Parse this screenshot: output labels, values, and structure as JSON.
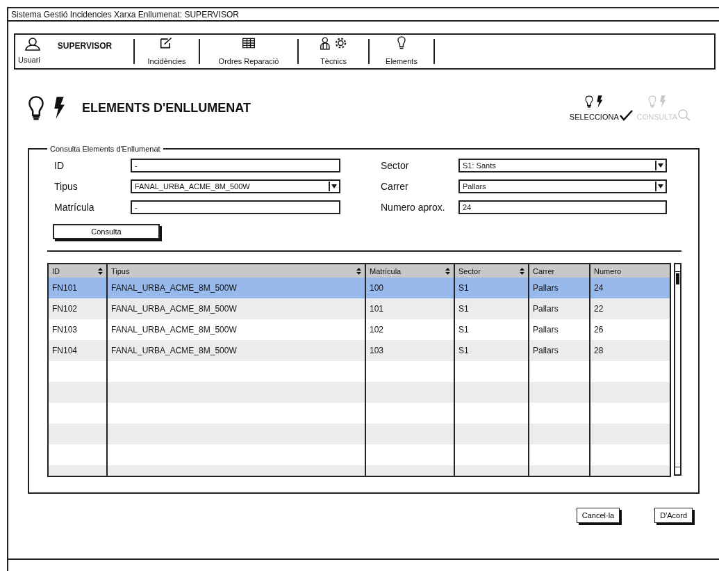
{
  "window": {
    "title": "Sistema Gestió Incidencies Xarxa Enllumenat: SUPERVISOR"
  },
  "nav": {
    "user": {
      "name": "SUPERVISOR",
      "label": "Usuari"
    },
    "items": [
      {
        "label": "Incidències"
      },
      {
        "label": "Ordres Reparació"
      },
      {
        "label": "Tècnics"
      },
      {
        "label": "Elements"
      }
    ]
  },
  "heading": "ELEMENTS D'ENLLUMENAT",
  "steps": [
    {
      "label": "SELECCIONA",
      "active": true
    },
    {
      "label": "CONSULTA",
      "active": false
    }
  ],
  "form": {
    "legend": "Consulta Elements d'Enllumenat",
    "fields": [
      {
        "label": "ID",
        "kind": "text",
        "value": "-"
      },
      {
        "label": "Sector",
        "kind": "select",
        "value": "S1: Sants"
      },
      {
        "label": "Tipus",
        "kind": "select",
        "value": "FANAL_URBA_ACME_8M_500W"
      },
      {
        "label": "Carrer",
        "kind": "select",
        "value": "Pallars"
      },
      {
        "label": "Matrícula",
        "kind": "text",
        "value": "-"
      },
      {
        "label": "Numero aprox.",
        "kind": "text",
        "value": "24"
      }
    ],
    "button": "Consulta"
  },
  "table": {
    "columns": [
      {
        "label": "ID",
        "sortable": true
      },
      {
        "label": "Tipus",
        "sortable": true
      },
      {
        "label": "Matrícula",
        "sortable": true
      },
      {
        "label": "Sector",
        "sortable": true
      },
      {
        "label": "Carrer",
        "sortable": false
      },
      {
        "label": "Numero",
        "sortable": false
      }
    ],
    "rows": [
      {
        "cells": [
          "FN101",
          "FANAL_URBA_ACME_8M_500W",
          "100",
          "S1",
          "Pallars",
          "24"
        ],
        "selected": true
      },
      {
        "cells": [
          "FN102",
          "FANAL_URBA_ACME_8M_500W",
          "101",
          "S1",
          "Pallars",
          "22"
        ],
        "selected": false
      },
      {
        "cells": [
          "FN103",
          "FANAL_URBA_ACME_8M_500W",
          "102",
          "S1",
          "Pallars",
          "26"
        ],
        "selected": false
      },
      {
        "cells": [
          "FN104",
          "FANAL_URBA_ACME_8M_500W",
          "103",
          "S1",
          "Pallars",
          "28"
        ],
        "selected": false
      }
    ]
  },
  "buttons": [
    "Cancel·la",
    "D'Acord"
  ]
}
